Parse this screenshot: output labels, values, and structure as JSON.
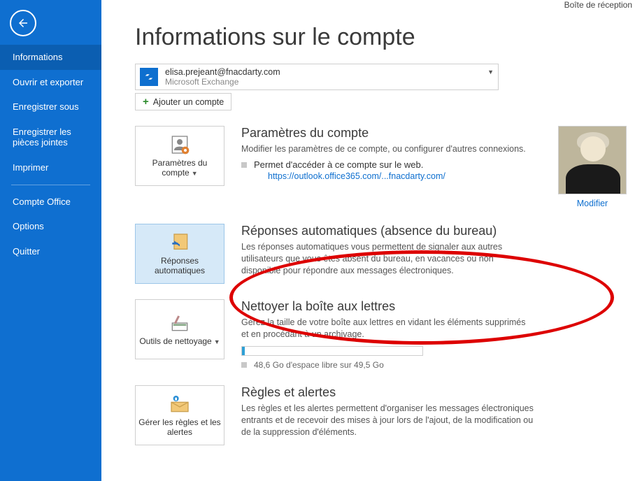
{
  "inbox_label": "Boîte de réception",
  "page_title": "Informations sur le compte",
  "sidebar": {
    "items": [
      {
        "label": "Informations",
        "active": true
      },
      {
        "label": "Ouvrir et exporter"
      },
      {
        "label": "Enregistrer sous"
      },
      {
        "label": "Enregistrer les pièces jointes"
      },
      {
        "label": "Imprimer"
      }
    ],
    "items2": [
      {
        "label": "Compte Office"
      },
      {
        "label": "Options"
      },
      {
        "label": "Quitter"
      }
    ]
  },
  "account": {
    "email": "elisa.prejeant@fnacdarty.com",
    "service": "Microsoft Exchange",
    "add_label": "Ajouter un compte"
  },
  "sec1": {
    "tile": "Paramètres du compte",
    "title": "Paramètres du compte",
    "desc": "Modifier les paramètres de ce compte, ou configurer d'autres connexions.",
    "bullet": "Permet d'accéder à ce compte sur le web.",
    "link": "https://outlook.office365.com/...fnacdarty.com/",
    "avatar_modify": "Modifier"
  },
  "sec2": {
    "tile": "Réponses automatiques",
    "title": "Réponses automatiques (absence du bureau)",
    "desc": "Les réponses automatiques vous permettent de signaler aux autres utilisateurs que vous êtes absent du bureau, en vacances ou non disponible pour répondre aux messages électroniques."
  },
  "sec3": {
    "tile": "Outils de nettoyage",
    "title": "Nettoyer la boîte aux lettres",
    "desc": "Gérez la taille de votre boîte aux lettres en vidant les éléments supprimés et en procédant à un archivage.",
    "storage": "48,6 Go d'espace libre sur 49,5 Go"
  },
  "sec4": {
    "tile": "Gérer les règles et les alertes",
    "title": "Règles et alertes",
    "desc": "Les règles et les alertes permettent d'organiser les messages électroniques entrants et de recevoir des mises à jour lors de l'ajout, de la modification ou de la suppression d'éléments."
  }
}
